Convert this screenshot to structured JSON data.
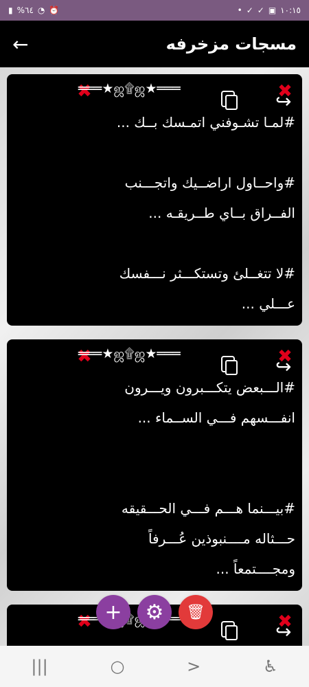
{
  "statusbar": {
    "time": "١٠:١٥",
    "battery": "%٦٤"
  },
  "appbar": {
    "title": "مسجات مزخرفه",
    "back_glyph": "←"
  },
  "decoration": "═══★ஜ۩ஜ★═══",
  "cards": [
    {
      "message": "#لمـا تشـوفني اتمـسك بــك ...\n\n#واحــاول اراضــيك واتجـــنب\nالفــراق بــاي طــريقـه ...\n\n#لا تتغــلئ وتستكـــثر نـــفسك\nعـــلي ..."
    },
    {
      "message": "#الـــبعض يتكـــبرون ويـــرون\nانفـــسهم فـــي الســماء ...\n\n\n#بيـــنما هـــم فـــي الحـــقيقه\nحـــثاله مــــنبوذين عُـــرفاً\nومجــــتمعاً ..."
    },
    {
      "message": ""
    }
  ],
  "fabs": {
    "add": "+",
    "settings": "⚙",
    "delete": "🗑"
  },
  "navbar": {
    "recent": "|||",
    "home": "○",
    "back": ">",
    "accessibility": "♿"
  },
  "colors": {
    "statusbar": "#7a5a80",
    "fab_primary": "#8b3fa0",
    "fab_delete": "#e23a3a",
    "x_icon": "#e0001b"
  }
}
